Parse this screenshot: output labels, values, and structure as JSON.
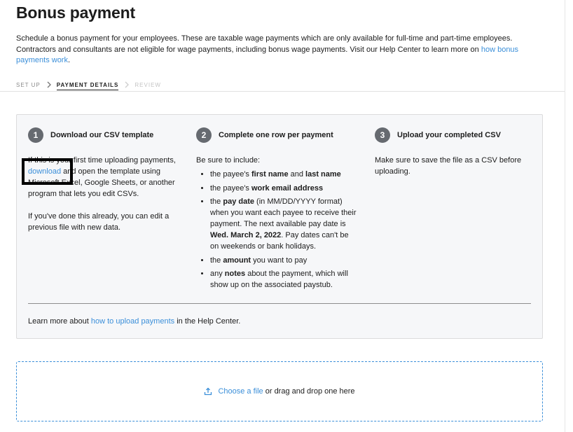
{
  "page": {
    "title": "Bonus payment",
    "intro_text": "Schedule a bonus payment for your employees. These are taxable wage payments which are only available for full-time and part-time employees. Contractors and consultants are not eligible for wage payments, including bonus wage payments. Visit our Help Center to learn more on ",
    "intro_link": "how bonus payments work",
    "intro_end": "."
  },
  "stepper": {
    "steps": [
      {
        "label": "SET UP",
        "state": "done"
      },
      {
        "label": "PAYMENT DETAILS",
        "state": "active"
      },
      {
        "label": "REVIEW",
        "state": "disabled"
      }
    ]
  },
  "instructions": {
    "col1": {
      "number": "1",
      "title": "Download our CSV template",
      "p1_before": "If this is your first time uploading payments, ",
      "p1_link": "download",
      "p1_after": " and open the template using Microsoft Excel, Google Sheets, or another program that lets you edit CSVs.",
      "p2": "If you've done this already, you can edit a previous file with new data."
    },
    "col2": {
      "number": "2",
      "title": "Complete one row per payment",
      "intro": "Be sure to include:",
      "item1_a": "the payee's ",
      "item1_b": "first name",
      "item1_c": " and ",
      "item1_d": "last name",
      "item2_a": "the payee's ",
      "item2_b": "work email address",
      "item3_a": "the ",
      "item3_b": "pay date",
      "item3_c": " (in MM/DD/YYYY format) when you want each payee to receive their payment. The next available pay date is ",
      "item3_d": "Wed. March 2, 2022",
      "item3_e": ". Pay dates can't be on weekends or bank holidays.",
      "item4_a": "the ",
      "item4_b": "amount",
      "item4_c": " you want to pay",
      "item5_a": "any ",
      "item5_b": "notes",
      "item5_c": " about the payment, which will show up on the associated paystub."
    },
    "col3": {
      "number": "3",
      "title": "Upload your completed CSV",
      "body": "Make sure to save the file as a CSV before uploading."
    },
    "footer_before": "Learn more about ",
    "footer_link": "how to upload payments",
    "footer_after": " in the Help Center."
  },
  "dropzone": {
    "link": "Choose a file",
    "text": " or drag and drop one here",
    "icon": "upload-icon"
  },
  "colors": {
    "link": "#3b8fd9",
    "card_bg": "#f6f7f9",
    "step_badge": "#666a70"
  }
}
